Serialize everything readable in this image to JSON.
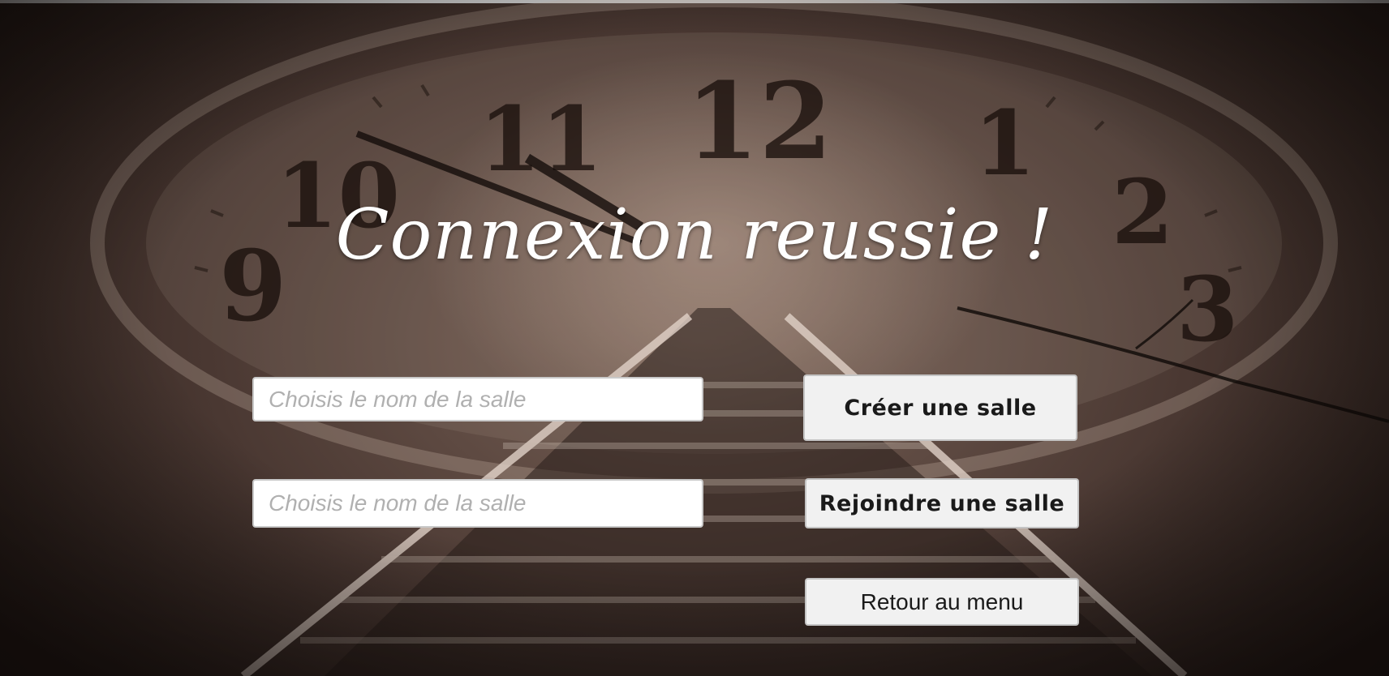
{
  "title": "Connexion reussie !",
  "create_room": {
    "input_placeholder": "Choisis le nom de la salle",
    "button_label": "Créer une salle"
  },
  "join_room": {
    "input_placeholder": "Choisis le nom de la salle",
    "button_label": "Rejoindre une salle"
  },
  "back_button_label": "Retour au menu",
  "background": {
    "description_icon": "clock-railway-background",
    "clock_numerals": [
      "12",
      "1",
      "2",
      "3",
      "9",
      "10",
      "11"
    ]
  },
  "colors": {
    "title": "#ffffff",
    "button_bg": "#f1f1f1",
    "input_bg": "#ffffff"
  }
}
